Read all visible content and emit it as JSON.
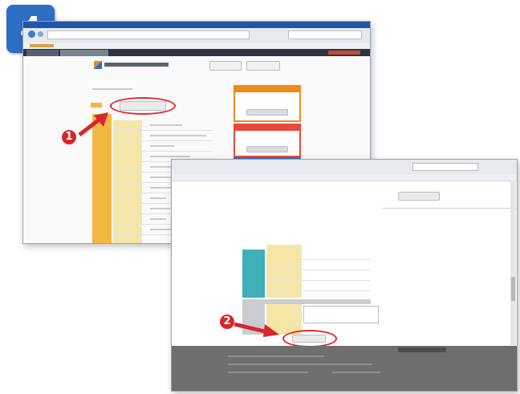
{
  "step": {
    "number": "4"
  },
  "markers": {
    "first": "1",
    "second": "2"
  },
  "colors": {
    "step_badge": "#2f6ec5",
    "marker": "#d7262d",
    "ring": "#e3262d",
    "orange_panel": "#f08a1c",
    "red_panel": "#e84a3a",
    "blue_panel": "#2a74c9",
    "green_panel": "#5aab2d",
    "gray_panel": "#9aa0a6",
    "form_left_band": "#f2b843",
    "teal_band": "#3fb0b7",
    "footer": "#6e6e6e"
  },
  "icons": [
    "back-arrow-icon",
    "forward-arrow-icon",
    "logo-icon",
    "pointer-arrow-icon"
  ]
}
